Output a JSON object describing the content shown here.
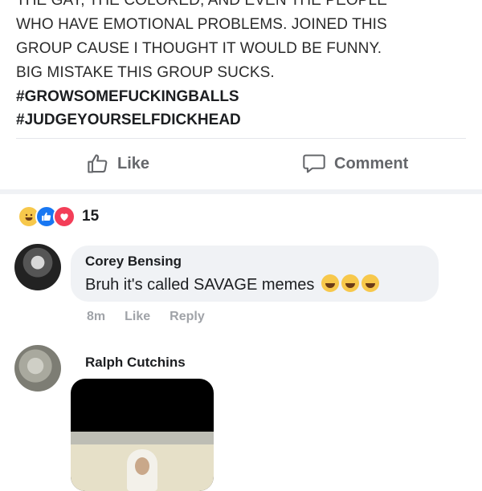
{
  "post": {
    "lines": [
      "THE GAY, THE COLORED, AND EVEN THE PEOPLE",
      "WHO HAVE EMOTIONAL PROBLEMS. JOINED THIS",
      "GROUP CAUSE I THOUGHT IT WOULD BE FUNNY.",
      "BIG MISTAKE THIS GROUP SUCKS."
    ],
    "hashtags": [
      "#GROWSOMEFUCKINGBALLS",
      "#JUDGEYOURSELFDICKHEAD"
    ]
  },
  "actions": {
    "like_label": "Like",
    "comment_label": "Comment"
  },
  "reactions": {
    "icons": [
      "haha-icon",
      "like-icon",
      "love-icon"
    ],
    "count": "15"
  },
  "comments": [
    {
      "author": "Corey Bensing",
      "text": "Bruh it's called SAVAGE memes",
      "emoji": [
        "laugh-cry-emoji",
        "laugh-cry-emoji",
        "laugh-cry-emoji"
      ],
      "time": "8m",
      "like_label": "Like",
      "reply_label": "Reply"
    },
    {
      "author": "Ralph Cutchins",
      "attachment": "image-attachment"
    }
  ],
  "colors": {
    "like_blue": "#1877f2",
    "love_red": "#f33e58",
    "haha_yellow": "#f7c84b",
    "bubble_bg": "#f0f2f5"
  }
}
